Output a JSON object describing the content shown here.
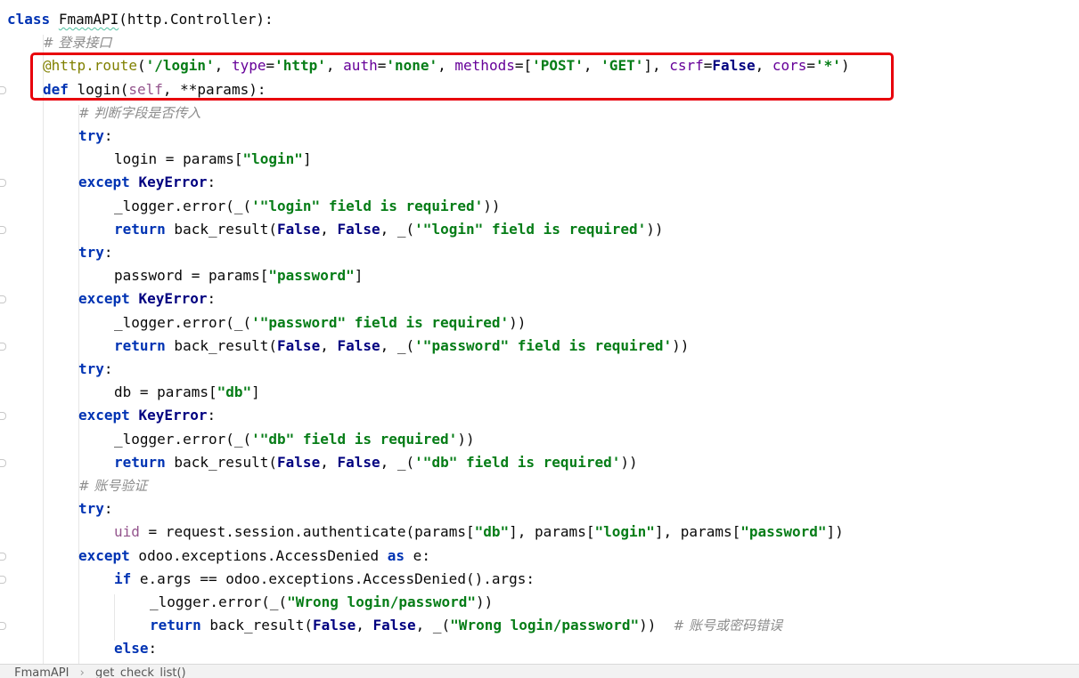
{
  "editor": {
    "lines": [
      {
        "indent": 0,
        "tokens": [
          {
            "t": "class",
            "c": "kw"
          },
          {
            "t": " "
          },
          {
            "t": "FmamAPI",
            "c": "typo"
          },
          {
            "t": "(http.Controller):"
          }
        ]
      },
      {
        "indent": 1,
        "tokens": [
          {
            "t": "# 登录接口",
            "c": "cm"
          }
        ]
      },
      {
        "indent": 1,
        "tokens": [
          {
            "t": "@http.route",
            "c": "dec"
          },
          {
            "t": "("
          },
          {
            "t": "'/login'",
            "c": "str"
          },
          {
            "t": ", "
          },
          {
            "t": "type",
            "c": "param"
          },
          {
            "t": "="
          },
          {
            "t": "'http'",
            "c": "str"
          },
          {
            "t": ", "
          },
          {
            "t": "auth",
            "c": "param"
          },
          {
            "t": "="
          },
          {
            "t": "'none'",
            "c": "str"
          },
          {
            "t": ", "
          },
          {
            "t": "methods",
            "c": "param"
          },
          {
            "t": "=["
          },
          {
            "t": "'POST'",
            "c": "str"
          },
          {
            "t": ", "
          },
          {
            "t": "'GET'",
            "c": "str"
          },
          {
            "t": "], "
          },
          {
            "t": "csrf",
            "c": "param"
          },
          {
            "t": "="
          },
          {
            "t": "False",
            "c": "kwb"
          },
          {
            "t": ", "
          },
          {
            "t": "cors",
            "c": "param"
          },
          {
            "t": "="
          },
          {
            "t": "'*'",
            "c": "str"
          },
          {
            "t": ")"
          }
        ]
      },
      {
        "indent": 1,
        "tokens": [
          {
            "t": "def",
            "c": "kw"
          },
          {
            "t": " login("
          },
          {
            "t": "self",
            "c": "selfw"
          },
          {
            "t": ", **params):"
          }
        ]
      },
      {
        "indent": 2,
        "tokens": [
          {
            "t": "# 判断字段是否传入",
            "c": "cm"
          }
        ]
      },
      {
        "indent": 2,
        "tokens": [
          {
            "t": "try",
            "c": "kw"
          },
          {
            "t": ":"
          }
        ]
      },
      {
        "indent": 3,
        "tokens": [
          {
            "t": "login = params["
          },
          {
            "t": "\"login\"",
            "c": "str"
          },
          {
            "t": "]"
          }
        ]
      },
      {
        "indent": 2,
        "tokens": [
          {
            "t": "except",
            "c": "kw"
          },
          {
            "t": " "
          },
          {
            "t": "KeyError",
            "c": "kwb"
          },
          {
            "t": ":"
          }
        ]
      },
      {
        "indent": 3,
        "tokens": [
          {
            "t": "_logger.error(_("
          },
          {
            "t": "'\"login\" field is required'",
            "c": "str"
          },
          {
            "t": "))"
          }
        ]
      },
      {
        "indent": 3,
        "tokens": [
          {
            "t": "return",
            "c": "kw"
          },
          {
            "t": " back_result("
          },
          {
            "t": "False",
            "c": "kwb"
          },
          {
            "t": ", "
          },
          {
            "t": "False",
            "c": "kwb"
          },
          {
            "t": ", _("
          },
          {
            "t": "'\"login\" field is required'",
            "c": "str"
          },
          {
            "t": "))"
          }
        ]
      },
      {
        "indent": 2,
        "tokens": [
          {
            "t": "try",
            "c": "kw"
          },
          {
            "t": ":"
          }
        ]
      },
      {
        "indent": 3,
        "tokens": [
          {
            "t": "password = params["
          },
          {
            "t": "\"password\"",
            "c": "str"
          },
          {
            "t": "]"
          }
        ]
      },
      {
        "indent": 2,
        "tokens": [
          {
            "t": "except",
            "c": "kw"
          },
          {
            "t": " "
          },
          {
            "t": "KeyError",
            "c": "kwb"
          },
          {
            "t": ":"
          }
        ]
      },
      {
        "indent": 3,
        "tokens": [
          {
            "t": "_logger.error(_("
          },
          {
            "t": "'\"password\" field is required'",
            "c": "str"
          },
          {
            "t": "))"
          }
        ]
      },
      {
        "indent": 3,
        "tokens": [
          {
            "t": "return",
            "c": "kw"
          },
          {
            "t": " back_result("
          },
          {
            "t": "False",
            "c": "kwb"
          },
          {
            "t": ", "
          },
          {
            "t": "False",
            "c": "kwb"
          },
          {
            "t": ", _("
          },
          {
            "t": "'\"password\" field is required'",
            "c": "str"
          },
          {
            "t": "))"
          }
        ]
      },
      {
        "indent": 2,
        "tokens": [
          {
            "t": "try",
            "c": "kw"
          },
          {
            "t": ":"
          }
        ]
      },
      {
        "indent": 3,
        "tokens": [
          {
            "t": "db = params["
          },
          {
            "t": "\"db\"",
            "c": "str"
          },
          {
            "t": "]"
          }
        ]
      },
      {
        "indent": 2,
        "tokens": [
          {
            "t": "except",
            "c": "kw"
          },
          {
            "t": " "
          },
          {
            "t": "KeyError",
            "c": "kwb"
          },
          {
            "t": ":"
          }
        ]
      },
      {
        "indent": 3,
        "tokens": [
          {
            "t": "_logger.error(_("
          },
          {
            "t": "'\"db\" field is required'",
            "c": "str"
          },
          {
            "t": "))"
          }
        ]
      },
      {
        "indent": 3,
        "tokens": [
          {
            "t": "return",
            "c": "kw"
          },
          {
            "t": " back_result("
          },
          {
            "t": "False",
            "c": "kwb"
          },
          {
            "t": ", "
          },
          {
            "t": "False",
            "c": "kwb"
          },
          {
            "t": ", _("
          },
          {
            "t": "'\"db\" field is required'",
            "c": "str"
          },
          {
            "t": "))"
          }
        ]
      },
      {
        "indent": 2,
        "tokens": [
          {
            "t": "# 账号验证",
            "c": "cm"
          }
        ]
      },
      {
        "indent": 2,
        "tokens": [
          {
            "t": "try",
            "c": "kw"
          },
          {
            "t": ":"
          }
        ]
      },
      {
        "indent": 3,
        "tokens": [
          {
            "t": "uid",
            "c": "selfw"
          },
          {
            "t": " = request.session.authenticate(params["
          },
          {
            "t": "\"db\"",
            "c": "str"
          },
          {
            "t": "], params["
          },
          {
            "t": "\"login\"",
            "c": "str"
          },
          {
            "t": "], params["
          },
          {
            "t": "\"password\"",
            "c": "str"
          },
          {
            "t": "])"
          }
        ]
      },
      {
        "indent": 2,
        "tokens": [
          {
            "t": "except",
            "c": "kw"
          },
          {
            "t": " odoo.exceptions.AccessDenied "
          },
          {
            "t": "as",
            "c": "kw"
          },
          {
            "t": " e:"
          }
        ]
      },
      {
        "indent": 3,
        "tokens": [
          {
            "t": "if",
            "c": "kw"
          },
          {
            "t": " e.args == odoo.exceptions.AccessDenied().args:"
          }
        ]
      },
      {
        "indent": 4,
        "tokens": [
          {
            "t": "_logger.error(_("
          },
          {
            "t": "\"Wrong login/password\"",
            "c": "str"
          },
          {
            "t": "))"
          }
        ]
      },
      {
        "indent": 4,
        "tokens": [
          {
            "t": "return",
            "c": "kw"
          },
          {
            "t": " back_result("
          },
          {
            "t": "False",
            "c": "kwb"
          },
          {
            "t": ", "
          },
          {
            "t": "False",
            "c": "kwb"
          },
          {
            "t": ", _("
          },
          {
            "t": "\"Wrong login/password\"",
            "c": "str"
          },
          {
            "t": "))  "
          },
          {
            "t": "# 账号或密码错误",
            "c": "cm"
          }
        ]
      },
      {
        "indent": 3,
        "tokens": [
          {
            "t": "else",
            "c": "kw"
          },
          {
            "t": ":"
          }
        ]
      }
    ]
  },
  "statusbar": {
    "crumbs": [
      "FmamAPI",
      "get_check_list()"
    ],
    "separator": "›"
  },
  "highlight": {
    "color": "#e8000b",
    "label": "route-and-def-highlight"
  }
}
